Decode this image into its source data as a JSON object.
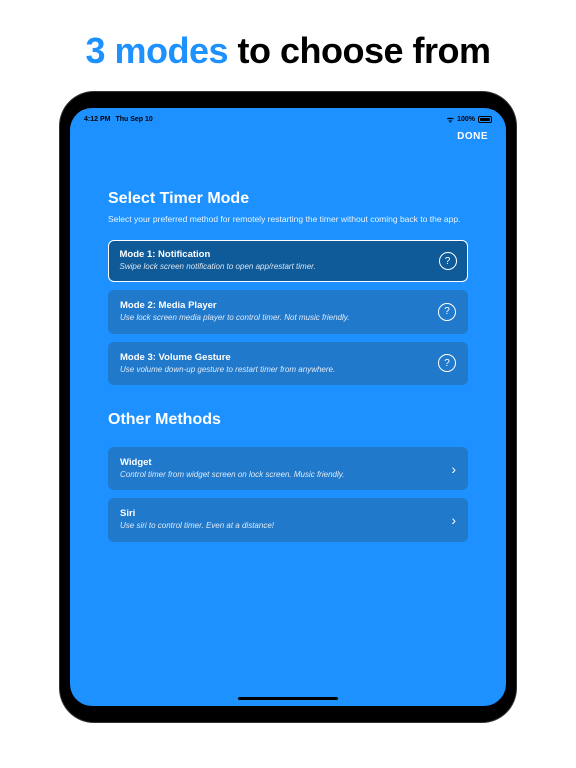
{
  "headline": {
    "accent": "3 modes",
    "rest": " to choose from"
  },
  "statusBar": {
    "time": "4:12 PM",
    "date": "Thu Sep 10",
    "battery": "100%"
  },
  "doneLabel": "DONE",
  "timerMode": {
    "title": "Select Timer Mode",
    "subtitle": "Select your preferred method for remotely restarting the timer without coming back to the app.",
    "options": [
      {
        "title": "Mode 1: Notification",
        "desc": "Swipe lock screen notification to open app/restart timer.",
        "selected": true
      },
      {
        "title": "Mode 2: Media Player",
        "desc": "Use lock screen media player to control timer. Not music friendly.",
        "selected": false
      },
      {
        "title": "Mode 3: Volume Gesture",
        "desc": "Use volume down-up gesture to restart timer from anywhere.",
        "selected": false
      }
    ]
  },
  "otherMethods": {
    "title": "Other Methods",
    "items": [
      {
        "title": "Widget",
        "desc": "Control timer from widget screen on lock screen. Music friendly."
      },
      {
        "title": "Siri",
        "desc": "Use siri to control timer. Even at a distance!"
      }
    ]
  }
}
